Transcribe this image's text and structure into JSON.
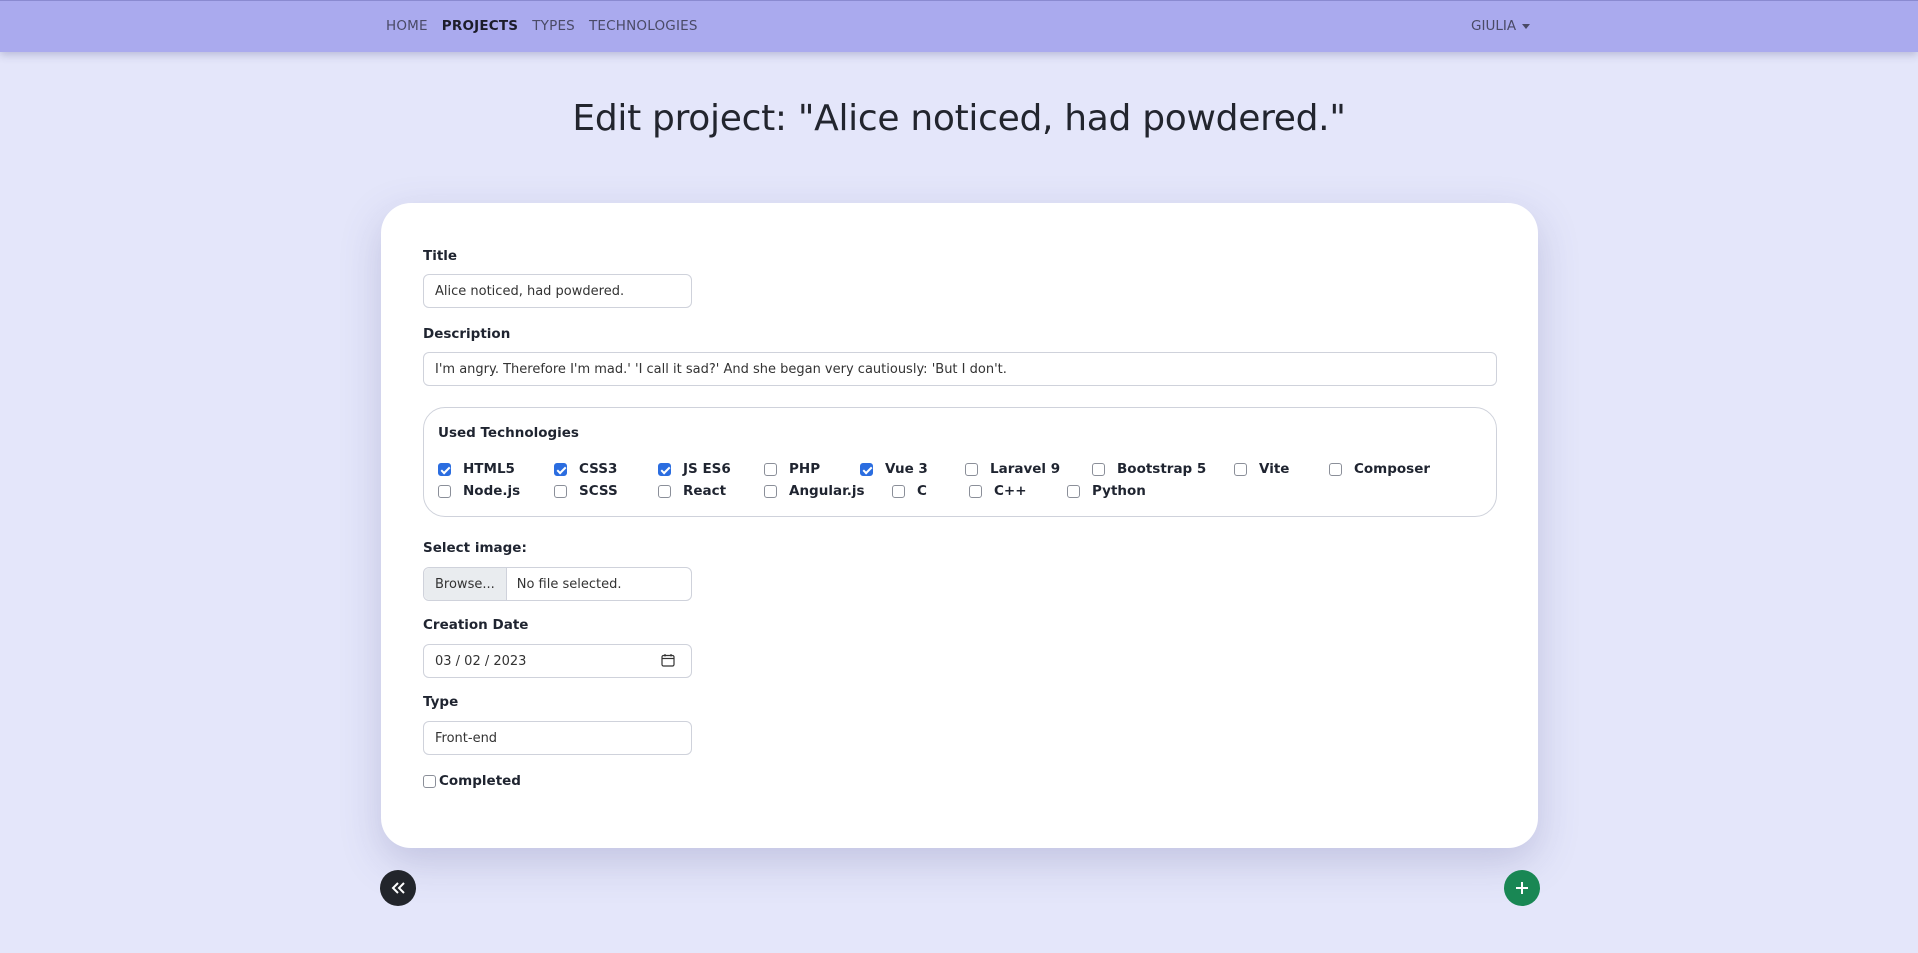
{
  "nav": {
    "links": [
      {
        "label": "HOME",
        "active": false
      },
      {
        "label": "PROJECTS",
        "active": true
      },
      {
        "label": "TYPES",
        "active": false
      },
      {
        "label": "TECHNOLOGIES",
        "active": false
      }
    ],
    "user": "GIULIA"
  },
  "page_title": "Edit project: \"Alice noticed, had powdered.\"",
  "form": {
    "title_label": "Title",
    "title_value": "Alice noticed, had powdered.",
    "description_label": "Description",
    "description_value": "I'm angry. Therefore I'm mad.' 'I call it sad?' And she began very cautiously: 'But I don't.",
    "technologies_legend": "Used Technologies",
    "technologies": [
      {
        "label": "HTML5",
        "checked": true
      },
      {
        "label": "CSS3",
        "checked": true
      },
      {
        "label": "JS ES6",
        "checked": true
      },
      {
        "label": "PHP",
        "checked": false
      },
      {
        "label": "Vue 3",
        "checked": true
      },
      {
        "label": "Laravel 9",
        "checked": false
      },
      {
        "label": "Bootstrap 5",
        "checked": false
      },
      {
        "label": "Vite",
        "checked": false
      },
      {
        "label": "Composer",
        "checked": false
      },
      {
        "label": "Node.js",
        "checked": false
      },
      {
        "label": "SCSS",
        "checked": false
      },
      {
        "label": "React",
        "checked": false
      },
      {
        "label": "Angular.js",
        "checked": false
      },
      {
        "label": "C",
        "checked": false
      },
      {
        "label": "C++",
        "checked": false
      },
      {
        "label": "Python",
        "checked": false
      }
    ],
    "image_label": "Select image:",
    "browse_label": "Browse...",
    "no_file_text": "No file selected.",
    "date_label": "Creation Date",
    "date_value": "03 / 02 / 2023",
    "type_label": "Type",
    "type_value": "Front-end",
    "completed_label": "Completed",
    "completed_checked": false
  },
  "buttons": {
    "back_icon": "double-chevron-left-icon",
    "add_icon": "plus-icon",
    "back_color": "#22252b",
    "add_color": "#198754"
  }
}
